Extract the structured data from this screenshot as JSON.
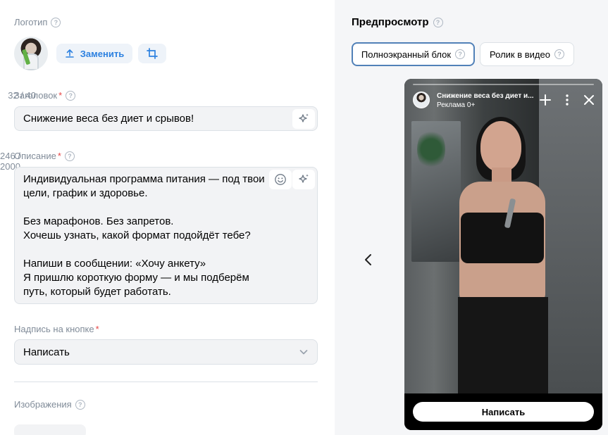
{
  "logo": {
    "label": "Логотип",
    "replace_label": "Заменить"
  },
  "title_field": {
    "label": "Заголовок",
    "counter": "32 / 40",
    "value": "Снижение веса без диет и срывов!"
  },
  "description_field": {
    "label": "Описание",
    "counter": "246 / 2000",
    "lines": [
      "Индивидуальная программа питания — под твои",
      "цели, график и здоровье.",
      "",
      "Без марафонов. Без запретов.",
      "Хочешь узнать, какой формат подойдёт тебе?",
      "",
      "Напиши в сообщении: «Хочу анкету»",
      "Я пришлю короткую форму — и мы подберём",
      "путь, который будет работать."
    ]
  },
  "button_field": {
    "label": "Надпись на кнопке",
    "value": "Написать"
  },
  "images": {
    "label": "Изображения"
  },
  "preview": {
    "title": "Предпросмотр",
    "tabs": [
      {
        "label": "Полноэкранный блок",
        "active": true
      },
      {
        "label": "Ролик в видео",
        "active": false
      }
    ],
    "card": {
      "title": "Снижение веса без диет и...",
      "subtitle": "Реклама 0+",
      "cta": "Написать"
    }
  },
  "colors": {
    "accent": "#2d81e0",
    "active_tab_border": "#5181b8",
    "required": "#e64646",
    "muted": "#818c99"
  },
  "icons": [
    "help-icon",
    "upload-icon",
    "crop-icon",
    "sparkle-icon",
    "emoji-icon",
    "chevron-down-icon",
    "chevron-left-icon",
    "plus-icon",
    "more-icon",
    "close-icon"
  ]
}
